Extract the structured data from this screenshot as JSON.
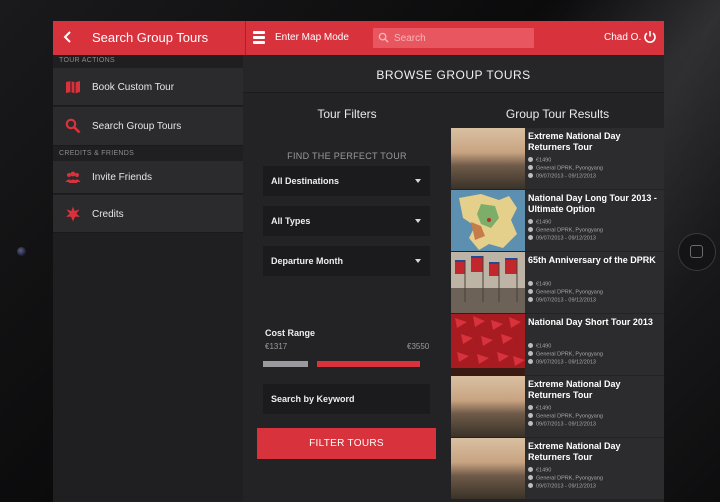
{
  "header": {
    "title": "Search Group Tours",
    "map_mode_label": "Enter Map Mode",
    "search_placeholder": "Search",
    "user_name": "Chad O."
  },
  "sidebar": {
    "sections": [
      {
        "label": "TOUR ACTIONS"
      },
      {
        "label": "CREDITS & FRIENDS"
      }
    ],
    "items": [
      {
        "label": "Book Custom Tour",
        "icon": "map-book-icon"
      },
      {
        "label": "Search Group Tours",
        "icon": "search-icon"
      },
      {
        "label": "Invite Friends",
        "icon": "people-icon"
      },
      {
        "label": "Credits",
        "icon": "star-icon"
      }
    ]
  },
  "main": {
    "title": "BROWSE GROUP TOURS",
    "filters": {
      "title": "Tour Filters",
      "find_label": "FIND THE PERFECT TOUR",
      "selects": [
        "All Destinations",
        "All Types",
        "Departure Month"
      ],
      "cost_label": "Cost Range",
      "cost_min": "€1317",
      "cost_max": "€3550",
      "keyword_placeholder": "Search by Keyword",
      "button_label": "FILTER TOURS"
    },
    "results": {
      "title": "Group Tour Results",
      "items": [
        {
          "title": "Extreme National Day Returners Tour",
          "price": "€1490",
          "location": "General DPRK, Pyongyang",
          "dates": "09/07/2013 - 09/12/2013",
          "thumb": "sunset"
        },
        {
          "title": "National Day Long Tour 2013 - Ultimate Option",
          "price": "€1490",
          "location": "General DPRK, Pyongyang",
          "dates": "09/07/2013 - 09/12/2013",
          "thumb": "map"
        },
        {
          "title": "65th Anniversary of the DPRK",
          "price": "€1490",
          "location": "General DPRK, Pyongyang",
          "dates": "09/07/2013 - 09/12/2013",
          "thumb": "flags"
        },
        {
          "title": "National Day Short Tour 2013",
          "price": "€1490",
          "location": "General DPRK, Pyongyang",
          "dates": "09/07/2013 - 09/12/2013",
          "thumb": "crowd"
        },
        {
          "title": "Extreme National Day Returners Tour",
          "price": "€1490",
          "location": "General DPRK, Pyongyang",
          "dates": "09/07/2013 - 09/12/2013",
          "thumb": "sunset"
        },
        {
          "title": "Extreme National Day Returners Tour",
          "price": "€1490",
          "location": "General DPRK, Pyongyang",
          "dates": "09/07/2013 - 09/12/2013",
          "thumb": "sunset"
        }
      ]
    }
  },
  "colors": {
    "accent": "#d8323c",
    "sidebar_bg": "#1f1f21",
    "panel_bg": "#232325"
  }
}
